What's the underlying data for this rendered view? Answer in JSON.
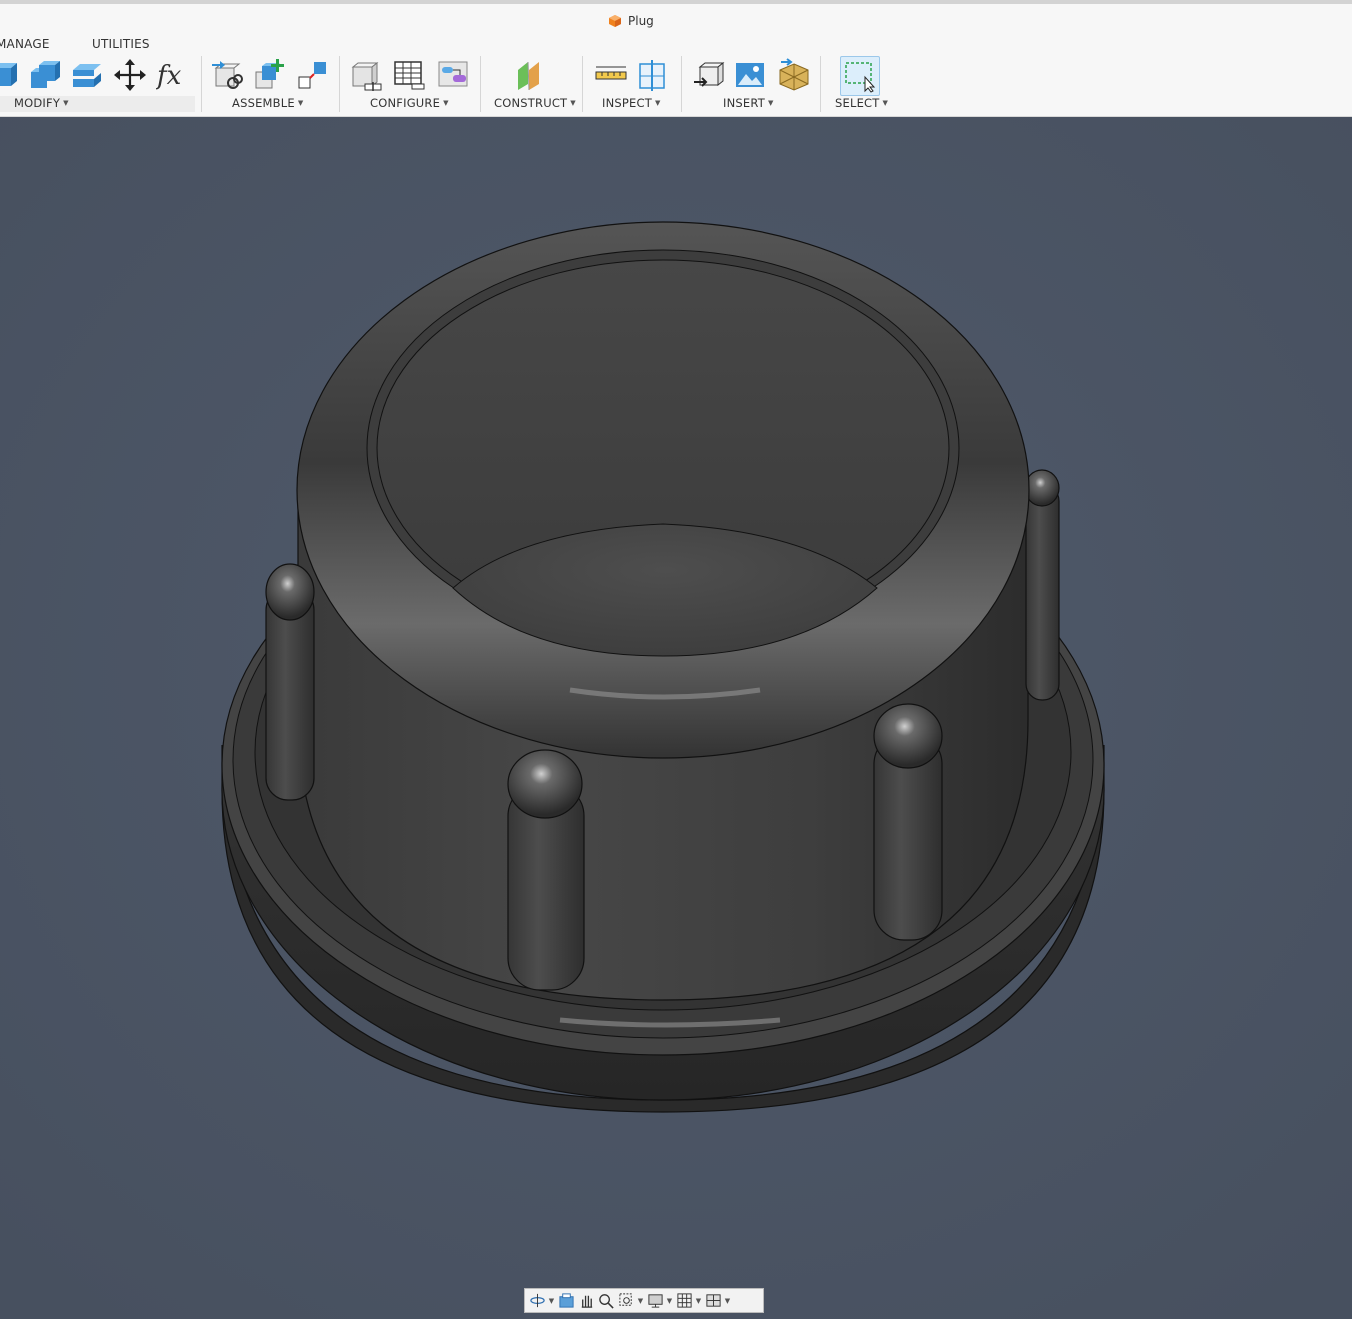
{
  "document": {
    "title": "Plug"
  },
  "tabs": {
    "manage": "MANAGE",
    "utilities": "UTILITIES"
  },
  "groups": {
    "modify": "MODIFY",
    "assemble": "ASSEMBLE",
    "configure": "CONFIGURE",
    "construct": "CONSTRUCT",
    "inspect": "INSPECT",
    "insert": "INSERT",
    "select": "SELECT"
  },
  "colors": {
    "viewport_bg": "#4b5566",
    "toolbar_bg": "#f7f7f7",
    "model": "#3b3b3b",
    "accent_blue": "#2f8fd6",
    "brand_orange": "#f0821e"
  },
  "icons": {
    "modify": [
      "extrude-icon",
      "combine-icon",
      "thicken-icon",
      "move-icon",
      "parameters-icon"
    ],
    "assemble": [
      "joint-icon",
      "new-component-icon",
      "rigid-group-icon"
    ],
    "configure": [
      "configure-icon",
      "table-icon",
      "config-rule-icon"
    ],
    "construct": [
      "offset-plane-icon"
    ],
    "inspect": [
      "measure-icon",
      "section-analysis-icon"
    ],
    "insert": [
      "insert-derive-icon",
      "insert-canvas-icon",
      "insert-mesh-icon"
    ],
    "select": [
      "window-select-icon"
    ],
    "navigation": [
      "orbit-icon",
      "look-at-icon",
      "pan-icon",
      "zoom-icon",
      "fit-icon",
      "display-settings-icon",
      "grid-icon",
      "viewports-icon"
    ]
  }
}
